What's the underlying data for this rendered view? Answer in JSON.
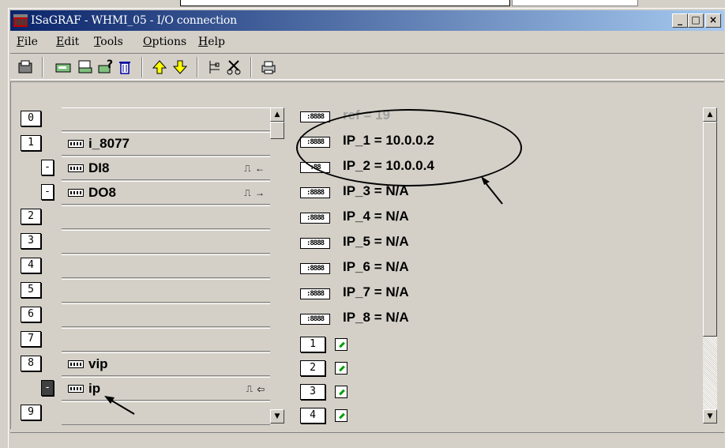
{
  "window": {
    "title": "ISaGRAF - WHMI_05 - I/O connection",
    "controls": {
      "minimize": "_",
      "maximize": "□",
      "close": "×"
    }
  },
  "menu": [
    {
      "label": "File",
      "accel": "F"
    },
    {
      "label": "Edit",
      "accel": "E"
    },
    {
      "label": "Tools",
      "accel": "T"
    },
    {
      "label": "Options",
      "accel": "O"
    },
    {
      "label": "Help",
      "accel": "H"
    }
  ],
  "toolbar": {
    "buttons": [
      "board-icon",
      "set-board-icon",
      "board-params-icon",
      "help-board-icon",
      "delete-icon",
      "move-up-icon",
      "move-down-icon",
      "connect-icon",
      "disconnect-icon",
      "print-icon"
    ]
  },
  "slots": [
    {
      "num": "0",
      "name": "",
      "icon": ""
    },
    {
      "num": "1",
      "name": "i_8077",
      "icon": "board"
    },
    {
      "num": "-",
      "name": "DI8",
      "icon": "board",
      "dir": "⎍ ←",
      "sub": true
    },
    {
      "num": "-",
      "name": "DO8",
      "icon": "board",
      "dir": "⎍ →",
      "sub": true
    },
    {
      "num": "2",
      "name": "",
      "icon": ""
    },
    {
      "num": "3",
      "name": "",
      "icon": ""
    },
    {
      "num": "4",
      "name": "",
      "icon": ""
    },
    {
      "num": "5",
      "name": "",
      "icon": ""
    },
    {
      "num": "6",
      "name": "",
      "icon": ""
    },
    {
      "num": "7",
      "name": "",
      "icon": ""
    },
    {
      "num": "8",
      "name": "vip",
      "icon": "board"
    },
    {
      "num": "-",
      "name": "ip",
      "icon": "board",
      "dir": "⎍ ⇦",
      "sub": true,
      "selected": true
    },
    {
      "num": "9",
      "name": "",
      "icon": ""
    }
  ],
  "channels": [
    {
      "chip": ":8888",
      "label": "ref = 19",
      "ref": true
    },
    {
      "chip": ":8888",
      "label": "IP_1 = 10.0.0.2"
    },
    {
      "chip": ":88",
      "label": "IP_2 = 10.0.0.4"
    },
    {
      "chip": ":8888",
      "label": "IP_3 = N/A"
    },
    {
      "chip": ":8888",
      "label": "IP_4 = N/A"
    },
    {
      "chip": ":8888",
      "label": "IP_5 = N/A"
    },
    {
      "chip": ":8888",
      "label": "IP_6 = N/A"
    },
    {
      "chip": ":8888",
      "label": "IP_7 = N/A"
    },
    {
      "chip": ":8888",
      "label": "IP_8 = N/A"
    }
  ],
  "numbered_channels": [
    "1",
    "2",
    "3",
    "4"
  ],
  "colors": {
    "title_start": "#0a246a",
    "title_end": "#a6caf0",
    "face": "#d4d0c8"
  }
}
